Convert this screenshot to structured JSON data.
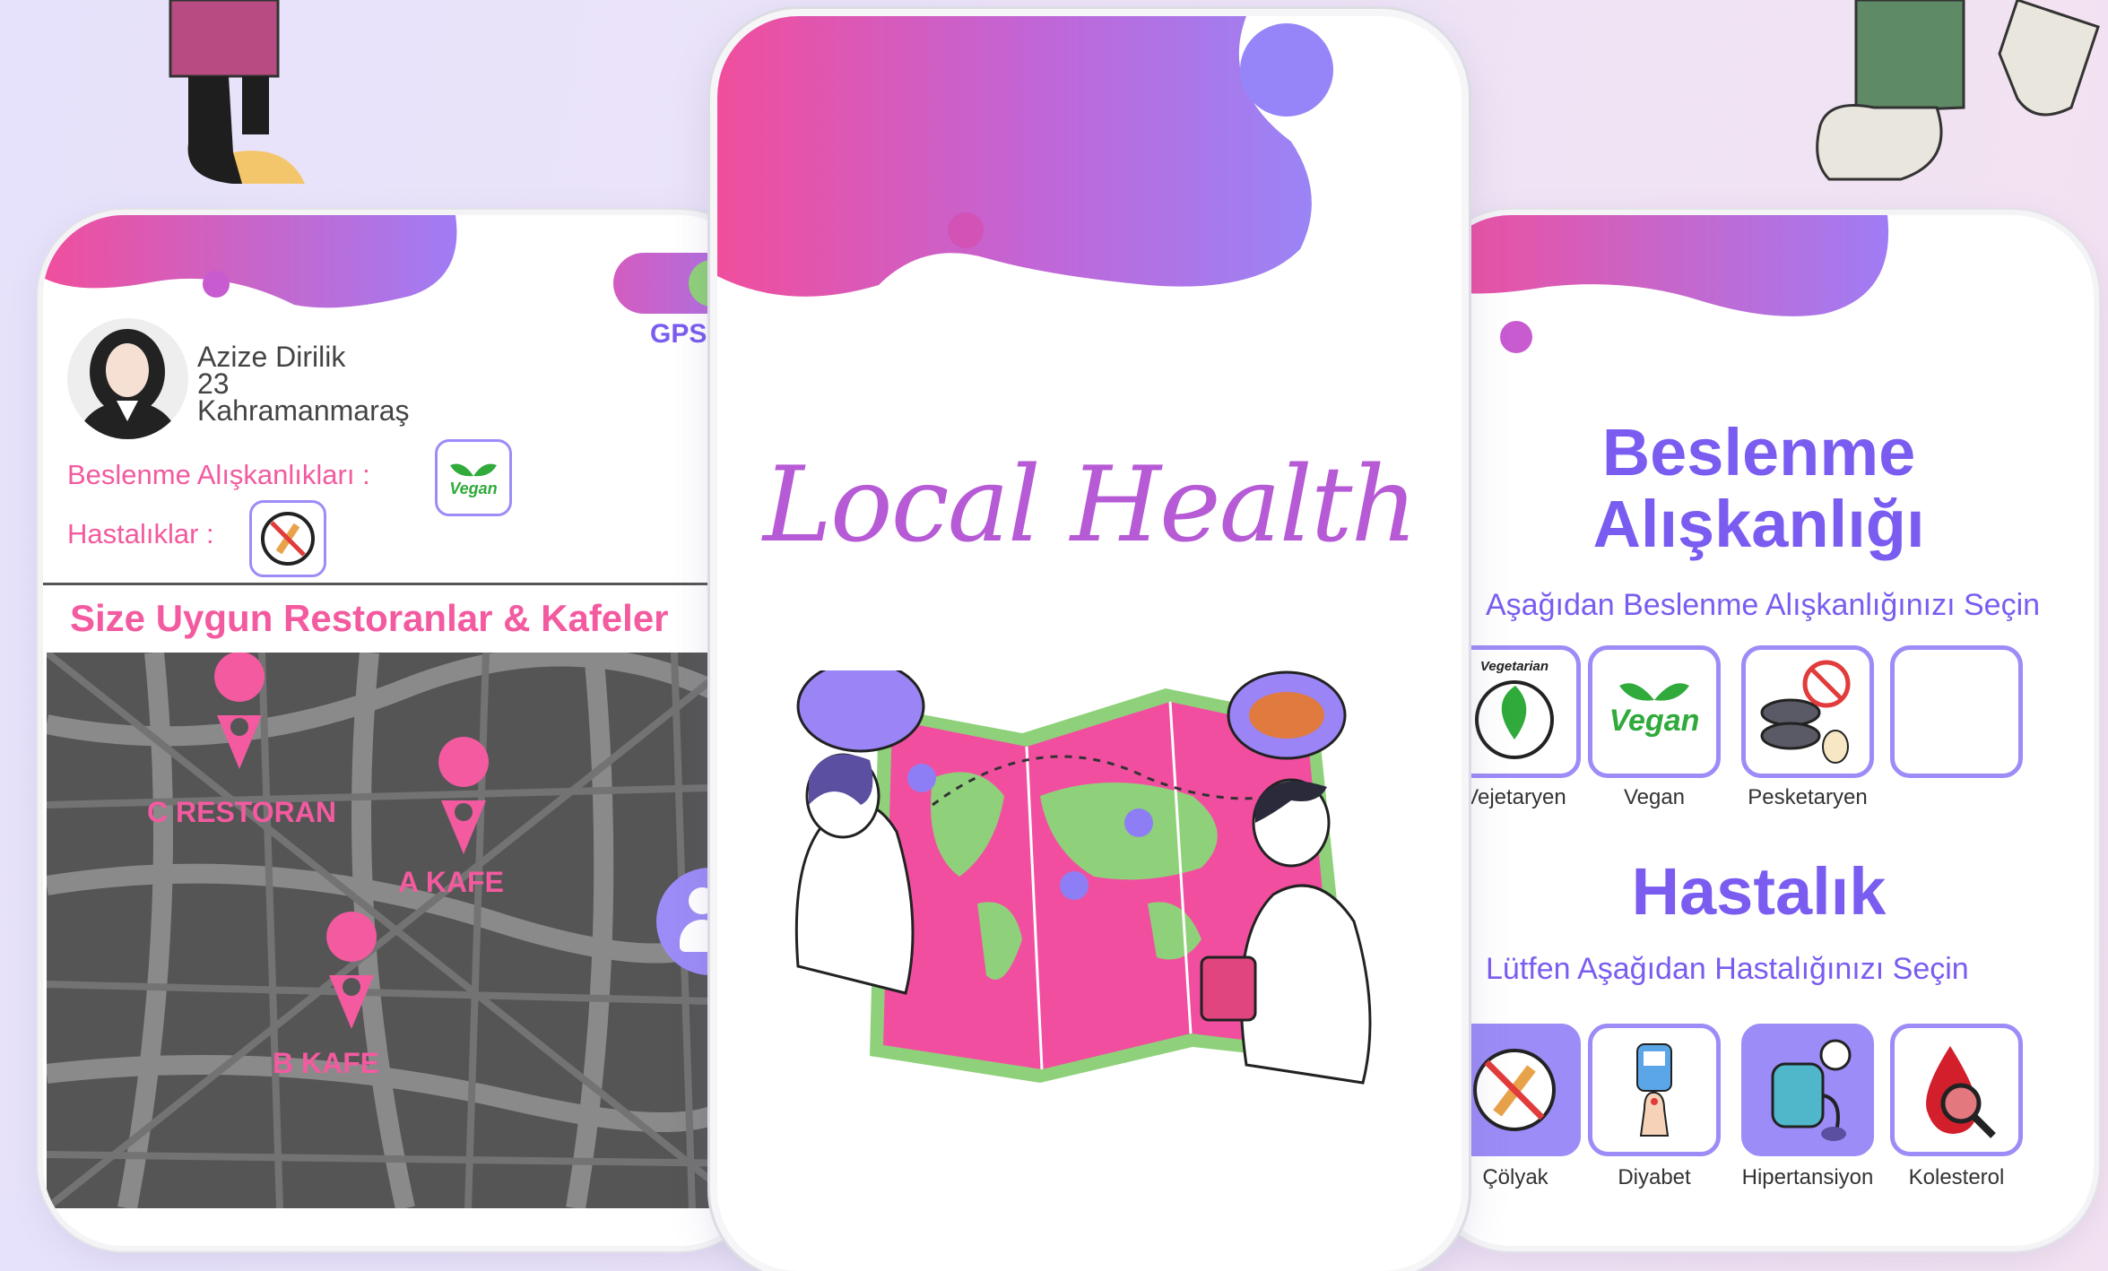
{
  "profile": {
    "name": "Azize Dirilik",
    "age": "23",
    "city": "Kahramanmaraş",
    "habits_label": "Beslenme Alışkanlıkları :",
    "diseases_label": "Hastalıklar :",
    "habit_badge": "Vegan"
  },
  "gps_label": "GPS",
  "restaurants_title": "Size Uygun Restoranlar & Kafeler",
  "map_places": [
    "C RESTORAN",
    "A KAFE",
    "B KAFE"
  ],
  "app_title": "Local Health",
  "nutrition": {
    "title_line1": "Beslenme",
    "title_line2": "Alışkanlığı",
    "subtitle": "Aşağıdan Beslenme Alışkanlığınızı Seçin",
    "options": [
      "Vejetaryen",
      "Vegan",
      "Pesketaryen"
    ],
    "vegan_badge": "Vegan",
    "vegetarian_badge": "Vegetarian"
  },
  "disease": {
    "title": "Hastalık",
    "subtitle": "Lütfen Aşağıdan Hastalığınızı Seçin",
    "options": [
      "Çölyak",
      "Diyabet",
      "Hipertansiyon",
      "Kolesterol"
    ]
  },
  "colors": {
    "pink": "#f35a9f",
    "purple": "#7a5cf0",
    "lavender": "#9b8cf7"
  }
}
